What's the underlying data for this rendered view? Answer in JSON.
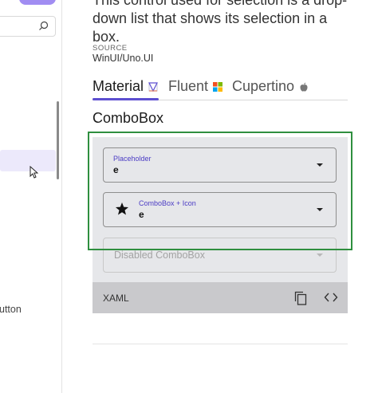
{
  "description": "This control used for selection is a drop-down list that shows its selection in a box.",
  "source": {
    "label": "SOURCE",
    "value": "WinUI/Uno.UI"
  },
  "tabs": [
    {
      "label": "Material",
      "icon": "material-logo-icon"
    },
    {
      "label": "Fluent",
      "icon": "microsoft-logo-icon"
    },
    {
      "label": "Cupertino",
      "icon": "apple-logo-icon"
    }
  ],
  "section_title": "ComboBox",
  "combos": {
    "placeholder": {
      "label": "Placeholder",
      "value": "e"
    },
    "icon": {
      "label": "ComboBox + Icon",
      "value": "e",
      "icon": "star-icon"
    },
    "disabled": {
      "placeholder": "Disabled ComboBox"
    }
  },
  "xaml_bar": {
    "label": "XAML",
    "copy_icon": "copy-icon",
    "code_icon": "code-icon"
  },
  "left_nav": {
    "partial_item_text": "utton"
  },
  "colors": {
    "accent": "#5d4fd0",
    "focus": "#2f8f3f",
    "card_bg": "#e6e7ea",
    "xaml_bg": "#c9c9cc"
  }
}
